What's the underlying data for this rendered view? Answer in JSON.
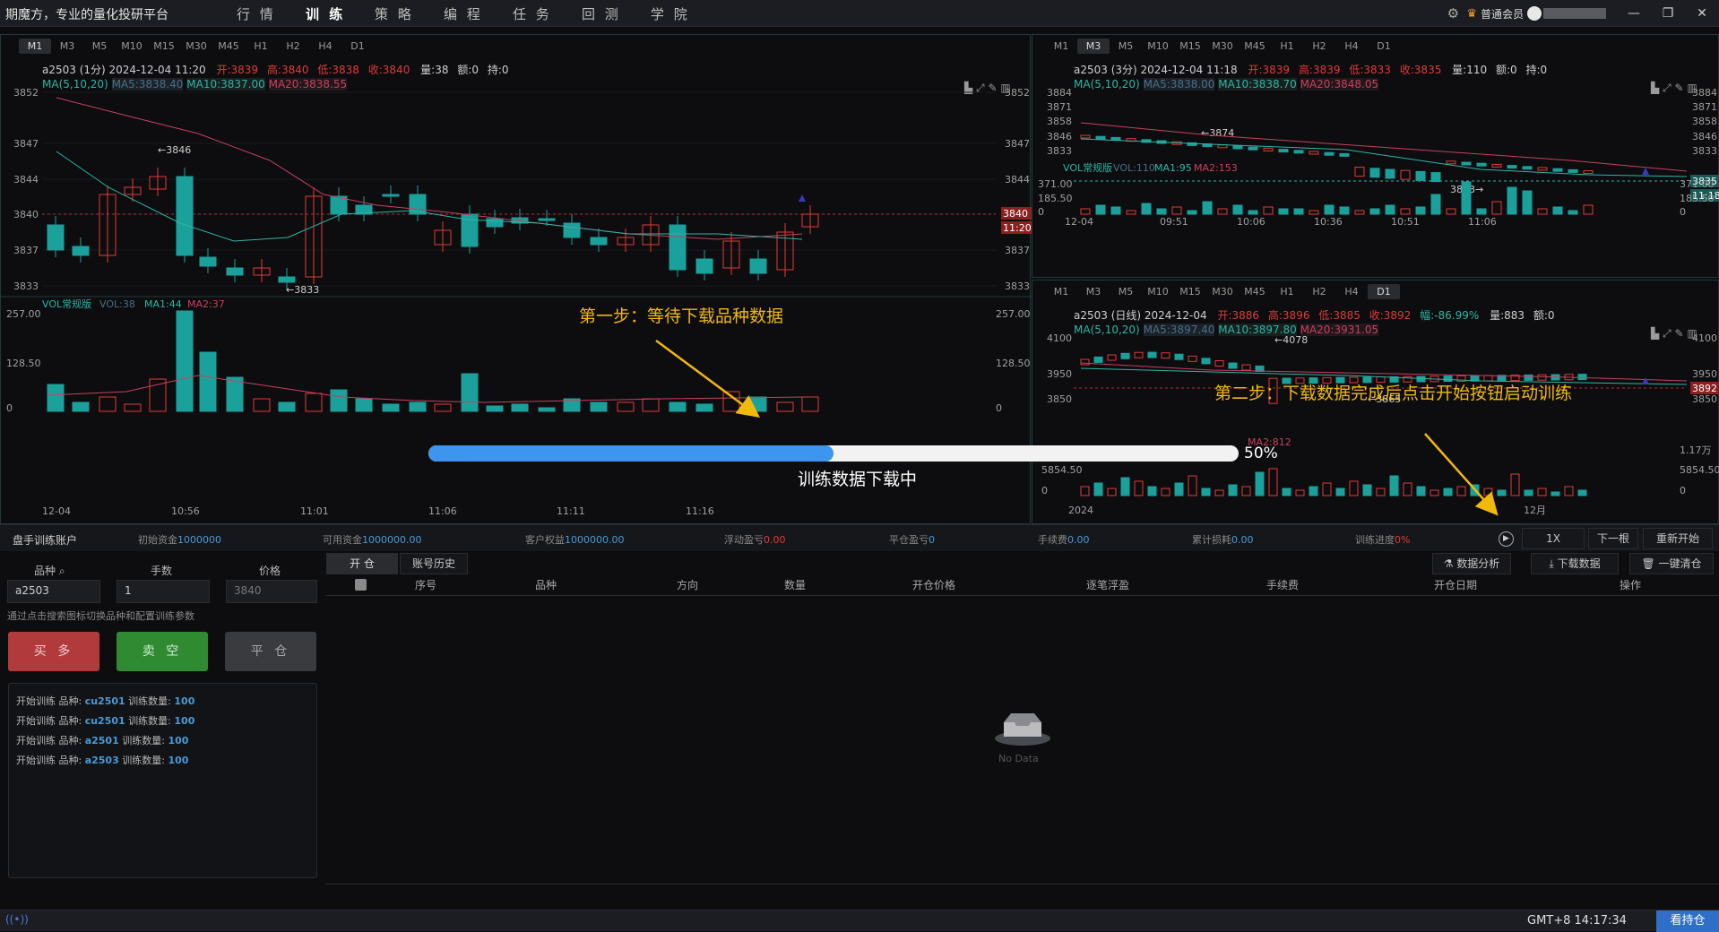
{
  "app": {
    "brand": "期魔方，专业的量化投研平台",
    "nav": [
      "行 情",
      "训 练",
      "策 略",
      "编 程",
      "任 务",
      "回 测",
      "学 院"
    ],
    "nav_active": 1,
    "member": "普通会员",
    "win_min": "—",
    "win_max": "❐",
    "win_close": "✕"
  },
  "timeframes": [
    "M1",
    "M3",
    "M5",
    "M10",
    "M15",
    "M30",
    "M45",
    "H1",
    "H2",
    "H4",
    "D1"
  ],
  "left_chart": {
    "selected_tf": "M1",
    "symbol_info": "a2503  (1分)  2024-12-04  11:20",
    "open": "开:3839",
    "high": "高:3840",
    "low": "低:3838",
    "close": "收:3840",
    "vol": "量:38",
    "amount": "额:0",
    "hold": "持:0",
    "ma_label": "MA(5,10,20)",
    "ma5": "MA5:3838.40",
    "ma10": "MA10:3837.00",
    "ma20": "MA20:3838.55",
    "price_ticks": [
      "3852",
      "3847",
      "3844",
      "3840",
      "3837",
      "3833"
    ],
    "price_tag": "3840",
    "time_tag": "11:20",
    "high_mark": "←3846",
    "low_mark": "←3833",
    "vol_label": "VOL常规版",
    "vol_v": "VOL:38",
    "vol_ma1": "MA1:44",
    "vol_ma2": "MA2:37",
    "vol_ticks": [
      "257.00",
      "128.50",
      "0"
    ],
    "x_ticks": [
      "12-04",
      "10:56",
      "11:01",
      "11:06",
      "11:11",
      "11:16"
    ]
  },
  "right_top_chart": {
    "selected_tf": "M3",
    "symbol_info": "a2503  (3分)  2024-12-04  11:18",
    "open": "开:3839",
    "high": "高:3839",
    "low": "低:3833",
    "close": "收:3835",
    "vol": "量:110",
    "amount": "额:0",
    "hold": "持:0",
    "ma_label": "MA(5,10,20)",
    "ma5": "MA5:3838.00",
    "ma10": "MA10:3838.70",
    "ma20": "MA20:3848.05",
    "price_ticks": [
      "3884",
      "3871",
      "3858",
      "3846",
      "3833"
    ],
    "price_tag": "3835",
    "time_tag": "11:18",
    "high_mark": "←3874",
    "low_mark": "3833→",
    "vol_label": "VOL常规版",
    "vol_v": "VOL:110",
    "vol_ma1": "MA1:95",
    "vol_ma2": "MA2:153",
    "vol_ticks": [
      "371.00",
      "185.50",
      "0"
    ],
    "x_ticks": [
      "12-04",
      "09:51",
      "10:06",
      "10:36",
      "10:51",
      "11:06"
    ]
  },
  "right_bottom_chart": {
    "selected_tf": "D1",
    "symbol_info": "a2503  (日线)  2024-12-04",
    "open": "开:3886",
    "high": "高:3896",
    "low": "低:3885",
    "close": "收:3892",
    "change": "幅:-86.99%",
    "vol": "量:883",
    "amount": "额:0",
    "ma_label": "MA(5,10,20)",
    "ma5": "MA5:3897.40",
    "ma10": "MA10:3897.80",
    "ma20": "MA20:3931.05",
    "price_ticks": [
      "4100",
      "3950",
      "3850"
    ],
    "price_tag": "3892",
    "high_mark": "←4078",
    "low_mark": "←3865",
    "vol_ticks": [
      "1.17万",
      "5854.50",
      "0"
    ],
    "vol_ma_val": "MA2:812",
    "x_ticks": [
      "2024",
      "12月"
    ]
  },
  "progress": {
    "percent": 50,
    "percent_label": "50%",
    "label": "训练数据下载中"
  },
  "annotations": {
    "step1": "第一步：等待下载品种数据",
    "step2": "第二步：下载数据完成后点击开始按钮启动训练"
  },
  "account": {
    "title": "盘手训练账户",
    "items": [
      {
        "label": "初始资金",
        "value": "1000000"
      },
      {
        "label": "可用资金",
        "value": "1000000.00"
      },
      {
        "label": "客户权益",
        "value": "1000000.00"
      },
      {
        "label": "浮动盈亏",
        "value": "0.00"
      },
      {
        "label": "平仓盈亏",
        "value": "0"
      },
      {
        "label": "手续费",
        "value": "0.00"
      },
      {
        "label": "累计损耗",
        "value": "0.00"
      },
      {
        "label": "训练进度",
        "value": "0%"
      }
    ],
    "speed": "1X",
    "next_bar": "下一根",
    "restart": "重新开始"
  },
  "order": {
    "symbol_label": "品种",
    "lots_label": "手数",
    "price_label": "价格",
    "symbol_value": "a2503",
    "lots_value": "1",
    "price_value": "3840",
    "hint": "通过点击搜索图标切换品种和配置训练参数",
    "buy": "买 多",
    "sell": "卖 空",
    "close": "平 仓"
  },
  "logs": [
    {
      "prefix": "开始训练 品种:",
      "symbol": "cu2501",
      "mid": "训练数量:",
      "count": "100"
    },
    {
      "prefix": "开始训练 品种:",
      "symbol": "cu2501",
      "mid": "训练数量:",
      "count": "100"
    },
    {
      "prefix": "开始训练 品种:",
      "symbol": "a2501",
      "mid": "训练数量:",
      "count": "100"
    },
    {
      "prefix": "开始训练 品种:",
      "symbol": "a2503",
      "mid": "训练数量:",
      "count": "100"
    }
  ],
  "table": {
    "tabs": [
      "开 仓",
      "账号历史"
    ],
    "actions": [
      "数据分析",
      "下载数据",
      "一键清仓"
    ],
    "columns": [
      "序号",
      "品种",
      "方向",
      "数量",
      "开仓价格",
      "逐笔浮盈",
      "手续费",
      "开仓日期",
      "操作"
    ],
    "empty": "No Data"
  },
  "status": {
    "time": "GMT+8 14:17:34",
    "hold_btn": "看持仓"
  },
  "colors": {
    "up": "#e03a3a",
    "down": "#1aa19b",
    "ma5": "#9aa4ad",
    "ma10": "#2fb5a5",
    "ma20": "#c84060",
    "accent": "#4aa0f0",
    "annot": "#f0b90b"
  }
}
